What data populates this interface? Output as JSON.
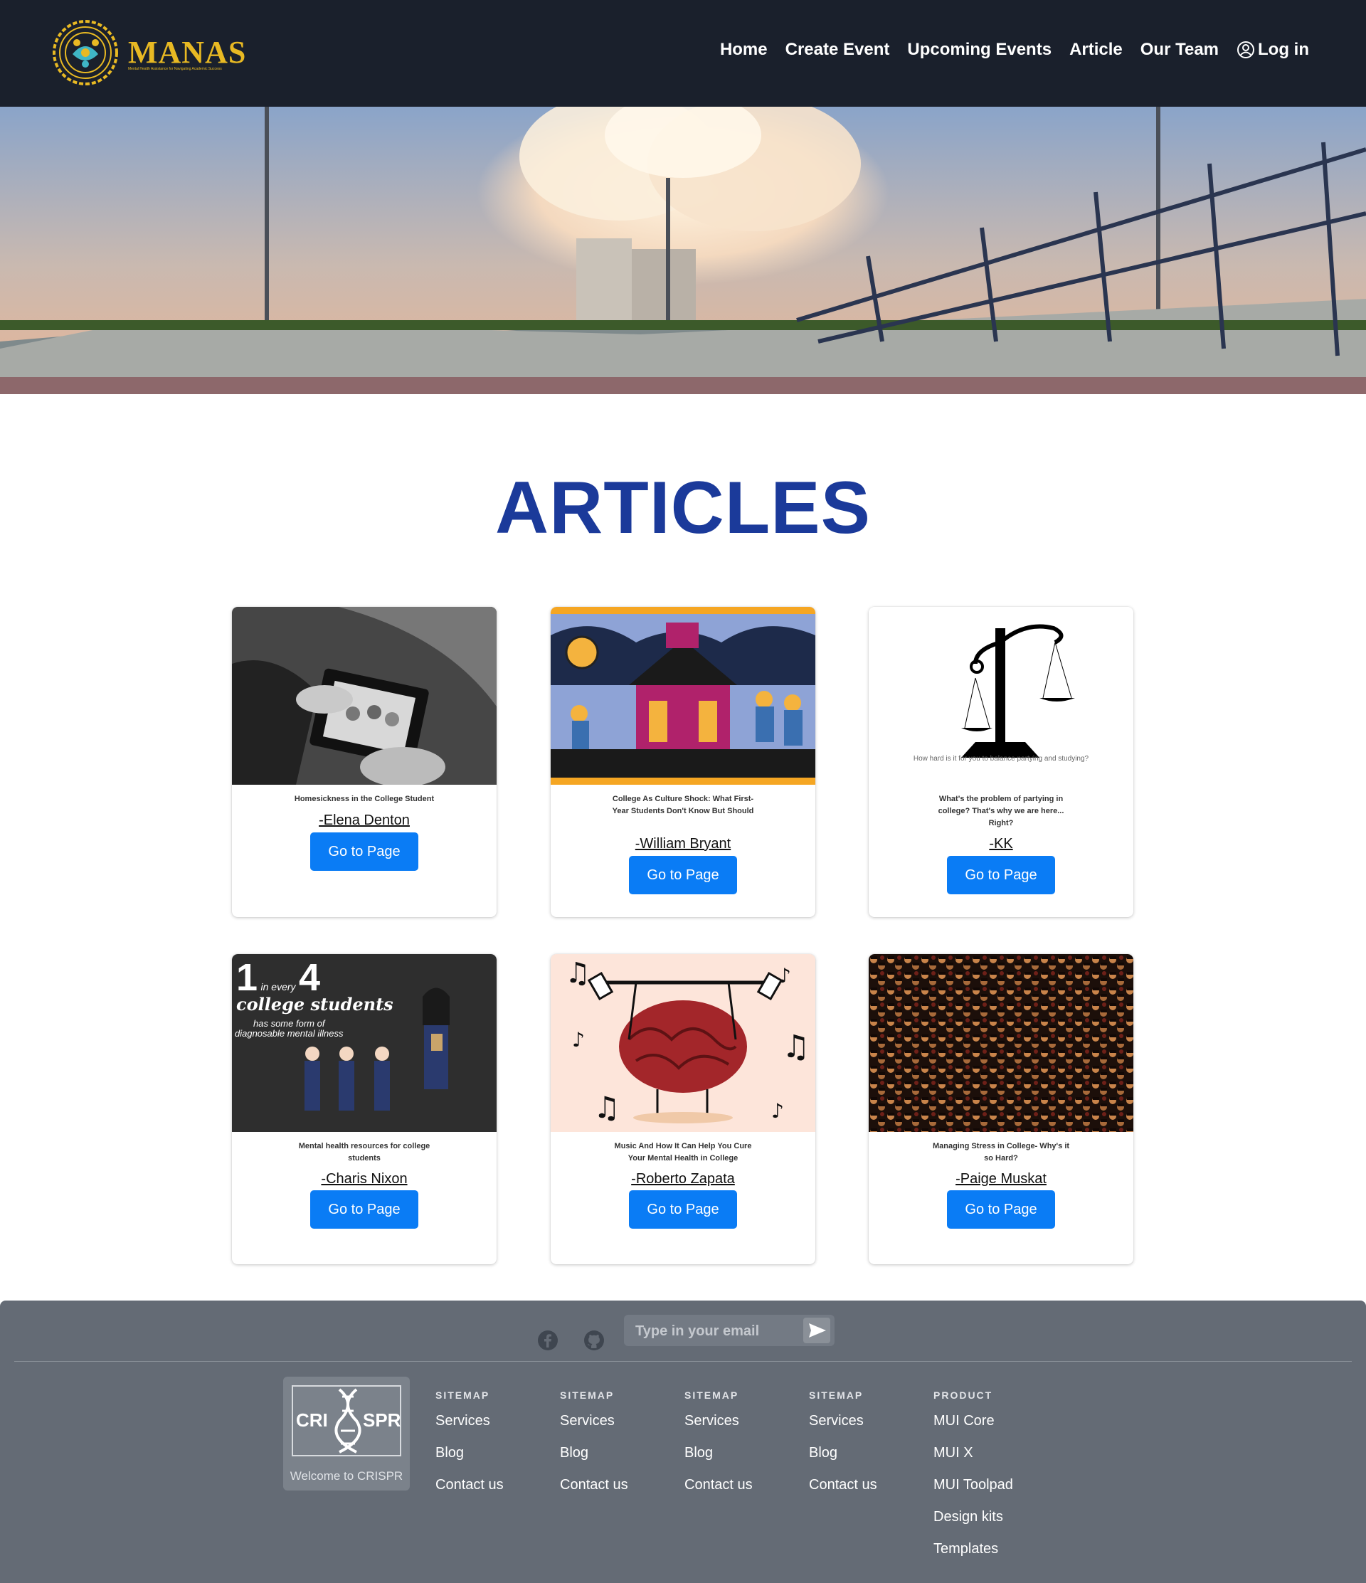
{
  "brand": {
    "name": "MANAS",
    "tagline": "Mental Health Assistance for Navigating Academic Success"
  },
  "nav": {
    "links": [
      "Home",
      "Create Event",
      "Upcoming Events",
      "Article",
      "Our Team"
    ],
    "login": "Log in"
  },
  "page": {
    "title": "ARTICLES"
  },
  "articles": [
    {
      "title": "Homesickness in the College Student",
      "author": "-Elena Denton",
      "button": "Go to Page",
      "image": "black-and-white photo of hands holding a family picture frame"
    },
    {
      "title": "College As Culture Shock: What First-Year Students Don't Know But Should",
      "author": "-William Bryant",
      "button": "Go to Page",
      "image": "illustration of a purple school building with graduates"
    },
    {
      "title": "What's the problem of partying in college? That's why we are here... Right?",
      "author": "-KK",
      "button": "Go to Page",
      "image_caption": "How hard is it for you to balance partying and studying?"
    },
    {
      "title": "Mental health resources for college students",
      "author": "-Charis Nixon",
      "button": "Go to Page",
      "image_text": {
        "num1": "1",
        "in_every": "in every",
        "num2": "4",
        "line2": "college students",
        "line3": "has some form of",
        "line4": "diagnosable mental illness"
      }
    },
    {
      "title": "Music And How It Can Help You Cure Your Mental Health in College",
      "author": "-Roberto Zapata",
      "button": "Go to Page",
      "image": "cartoon brain lifting a barbell surrounded by music notes"
    },
    {
      "title": "Managing Stress in College- Why's it so Hard?",
      "author": "-Paige Muskat",
      "button": "Go to Page",
      "image": "aerial view of a crowd of graduates in caps"
    }
  ],
  "footer": {
    "email_placeholder": "Type in your email",
    "crispr": {
      "logo_left": "CRI",
      "logo_right": "SPR",
      "caption": "Welcome to CRISPR"
    },
    "columns": [
      {
        "heading": "SITEMAP",
        "links": [
          "Services",
          "Blog",
          "Contact us"
        ]
      },
      {
        "heading": "SITEMAP",
        "links": [
          "Services",
          "Blog",
          "Contact us"
        ]
      },
      {
        "heading": "SITEMAP",
        "links": [
          "Services",
          "Blog",
          "Contact us"
        ]
      },
      {
        "heading": "SITEMAP",
        "links": [
          "Services",
          "Blog",
          "Contact us"
        ]
      },
      {
        "heading": "PRODUCT",
        "links": [
          "MUI Core",
          "MUI X",
          "MUI Toolpad",
          "Design kits",
          "Templates"
        ]
      }
    ]
  },
  "colors": {
    "nav_bg": "#1a202c",
    "title_blue": "#1b3a9a",
    "button_blue": "#0a7cf5",
    "footer_bg": "#646b75",
    "logo_gold": "#e8b923"
  }
}
